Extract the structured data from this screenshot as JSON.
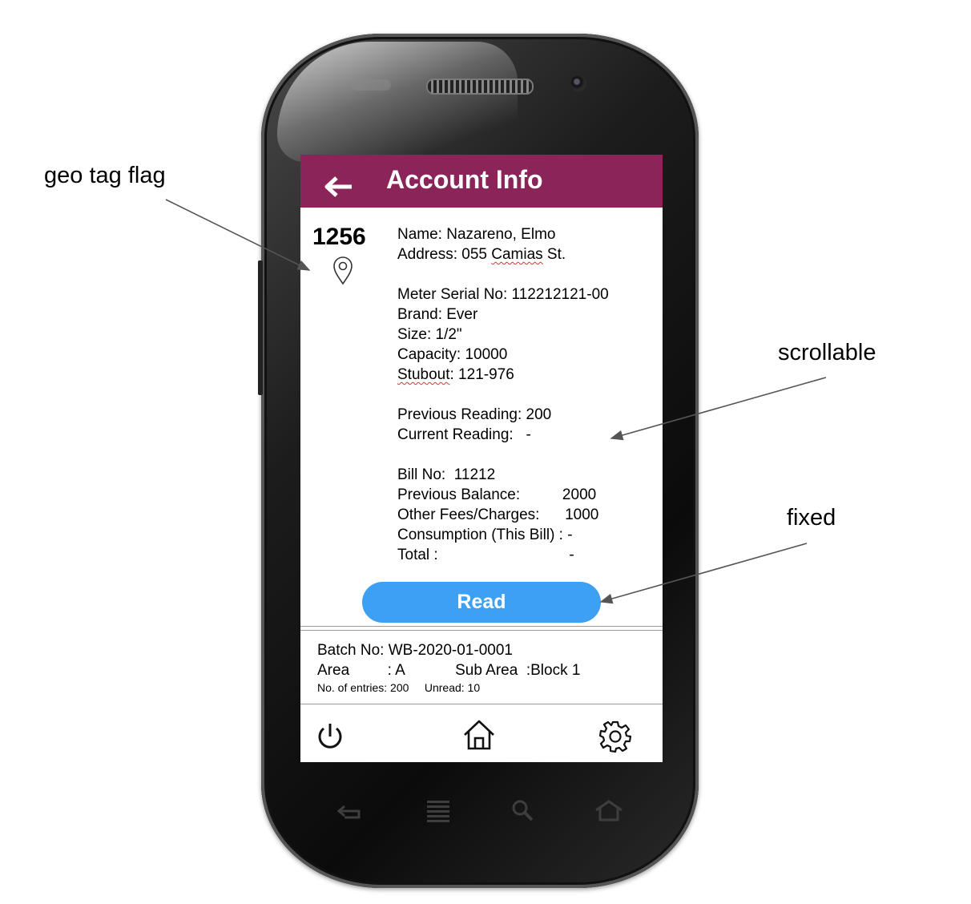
{
  "annotations": {
    "geo_tag": "geo tag flag",
    "scrollable": "scrollable",
    "fixed": "fixed"
  },
  "app_bar": {
    "back_icon": "arrow-left-icon",
    "title": "Account Info",
    "color": "#8b2458"
  },
  "account": {
    "number": "1256",
    "geo_icon": "map-pin-icon",
    "name_row": "Name: Nazareno, Elmo",
    "address_prefix": "Address: 055 ",
    "address_street": "Camias",
    "address_suffix": " St.",
    "meter_serial": "Meter Serial No: 112212121-00",
    "brand": "Brand: Ever",
    "size": "Size: 1/2\"",
    "capacity": "Capacity: 10000",
    "stubout_label": "Stubout",
    "stubout_value": ": 121-976",
    "previous_reading": "Previous Reading: 200",
    "current_reading": "Current Reading:   -",
    "bill_no": "Bill No:  11212",
    "previous_balance": "Previous Balance:          2000",
    "other_fees": "Other Fees/Charges:      1000",
    "consumption": "Consumption (This Bill) : -",
    "total": "Total :                               -"
  },
  "read_button": {
    "label": "Read",
    "color": "#3ea0f2"
  },
  "batch": {
    "batch_no": "Batch No: WB-2020-01-0001",
    "area_row": "Area         : A            Sub Area  :Block 1",
    "entries_row": "No. of entries: 200     Unread: 10"
  },
  "bottom_nav": {
    "items": [
      "power-icon",
      "home-icon",
      "gear-icon"
    ]
  },
  "hardware_nav": [
    "back-icon",
    "menu-icon",
    "search-icon",
    "home-icon"
  ]
}
